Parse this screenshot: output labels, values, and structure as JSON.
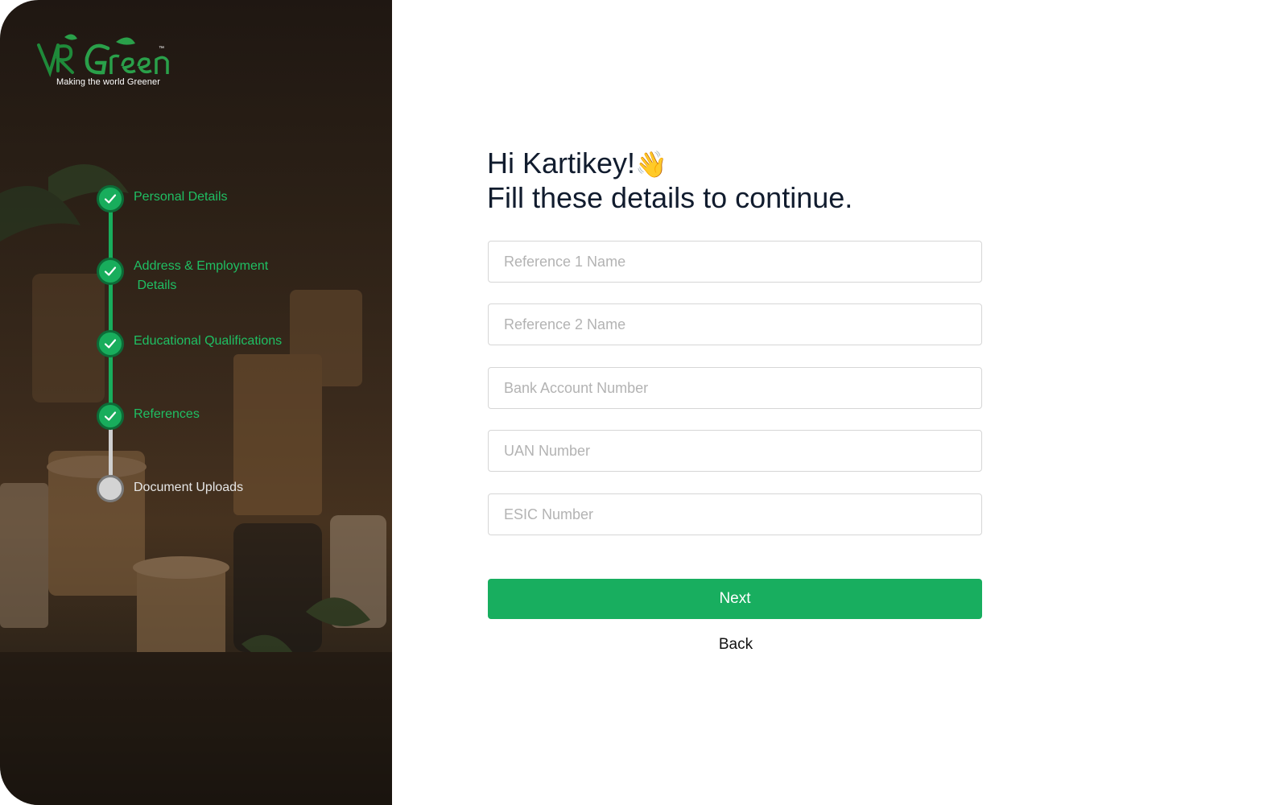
{
  "brand": {
    "logo_text": "VR Green",
    "tm": "™",
    "tagline": "Making the world Greener"
  },
  "steps": [
    {
      "label": "Personal Details",
      "status": "done"
    },
    {
      "label_line1": "Address & Employment",
      "label_line2": " Details",
      "status": "done"
    },
    {
      "label": "Educational Qualifications",
      "status": "done"
    },
    {
      "label": "References",
      "status": "done"
    },
    {
      "label": "Document Uploads",
      "status": "pending"
    }
  ],
  "form": {
    "greeting": "Hi Kartikey!",
    "greeting_emoji": "👋",
    "subtitle": "Fill these details to continue.",
    "fields": [
      {
        "placeholder": "Reference 1 Name",
        "value": ""
      },
      {
        "placeholder": "Reference 2 Name",
        "value": ""
      },
      {
        "placeholder": "Bank Account Number",
        "value": ""
      },
      {
        "placeholder": "UAN Number",
        "value": ""
      },
      {
        "placeholder": "ESIC Number",
        "value": ""
      }
    ],
    "next_label": "Next",
    "back_label": "Back"
  },
  "colors": {
    "accent": "#18ae5f",
    "step_done_text": "#1fbf63",
    "heading": "#111c2e",
    "left_panel_bg": "#2b2016"
  }
}
